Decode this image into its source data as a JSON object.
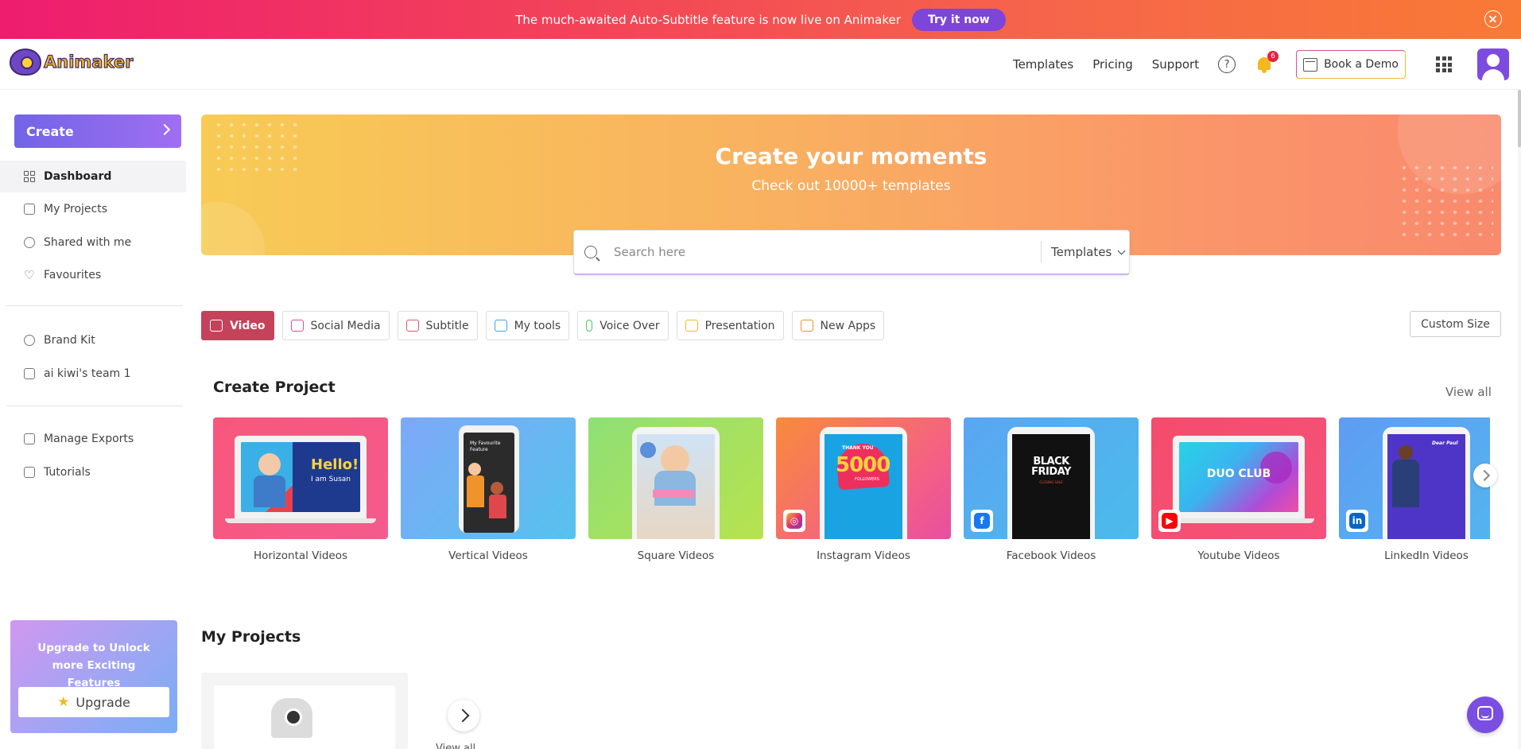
{
  "banner": {
    "message": "The much-awaited Auto-Subtitle feature is now live on Animaker",
    "cta": "Try it now"
  },
  "header": {
    "logo_text": "Animaker",
    "nav": [
      "Templates",
      "Pricing",
      "Support"
    ],
    "help_symbol": "?",
    "notification_count": "6",
    "book_demo": "Book a Demo"
  },
  "sidebar": {
    "create": "Create",
    "items": [
      {
        "label": "Dashboard",
        "icon": "dashboard-grid-icon"
      },
      {
        "label": "My Projects",
        "icon": "projects-icon"
      },
      {
        "label": "Shared with me",
        "icon": "shared-user-icon"
      },
      {
        "label": "Favourites",
        "icon": "heart-icon"
      },
      {
        "label": "Brand Kit",
        "icon": "brand-kit-icon"
      },
      {
        "label": "ai kiwi's team 1",
        "icon": "team-icon"
      },
      {
        "label": "Manage Exports",
        "icon": "exports-icon"
      },
      {
        "label": "Tutorials",
        "icon": "tutorials-icon"
      }
    ],
    "upgrade_text": "Upgrade to Unlock more Exciting Features",
    "upgrade_button": "Upgrade"
  },
  "hero": {
    "title": "Create your moments",
    "subtitle": "Check out 10000+ templates"
  },
  "search": {
    "placeholder": "Search here",
    "category": "Templates"
  },
  "tabs": [
    {
      "label": "Video",
      "active": true,
      "color": "#c5425b"
    },
    {
      "label": "Social Media",
      "color": "#e04c9c"
    },
    {
      "label": "Subtitle",
      "color": "#e0566a"
    },
    {
      "label": "My tools",
      "color": "#4aa0e0"
    },
    {
      "label": "Voice Over",
      "color": "#4cc46e"
    },
    {
      "label": "Presentation",
      "color": "#f0b81f"
    },
    {
      "label": "New Apps",
      "color": "#f08f2a"
    }
  ],
  "custom_size": "Custom Size",
  "create_project": {
    "title": "Create Project",
    "view_all": "View all",
    "cards": [
      {
        "label": "Horizontal Videos",
        "thumb_text": "Hello!",
        "thumb_sub": "I am Susan"
      },
      {
        "label": "Vertical Videos",
        "thumb_text": "My Favourite Feature"
      },
      {
        "label": "Square Videos",
        "thumb_text": ""
      },
      {
        "label": "Instagram Videos",
        "thumb_text": "5000",
        "thumb_sub": "FOLLOWERS",
        "thumb_top": "THANK YOU"
      },
      {
        "label": "Facebook Videos",
        "thumb_text": "BLACK FRIDAY",
        "thumb_sub": "CLOSING SALE"
      },
      {
        "label": "Youtube Videos",
        "thumb_text": "DUO CLUB"
      },
      {
        "label": "LinkedIn Videos",
        "thumb_text": "Dear Paul"
      }
    ]
  },
  "my_projects": {
    "title": "My Projects",
    "view_all": "View all"
  }
}
